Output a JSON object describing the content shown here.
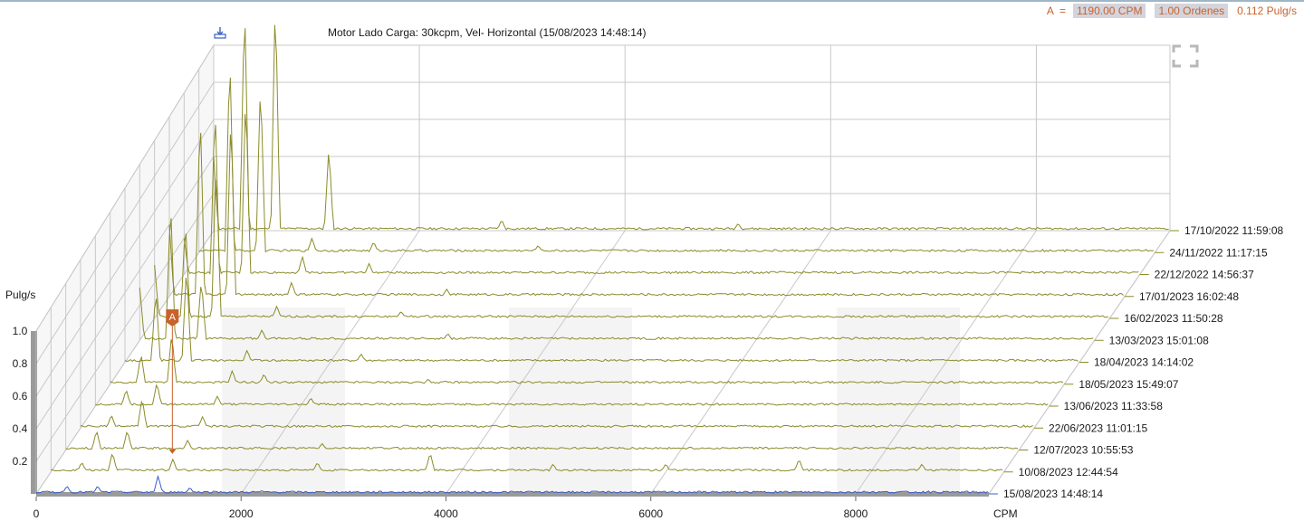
{
  "header": {
    "cursor_label": "A",
    "cursor_equals": "=",
    "cursor_frequency": "1190.00 CPM",
    "cursor_orders": "1.00 Ordenes",
    "cursor_amplitude": "0.112 Pulg/s"
  },
  "icons": {
    "download": "download-icon",
    "expand": "expand-icon"
  },
  "colors": {
    "trace": "#8b8b2a",
    "current_trace": "#3a5fc8",
    "marker": "#c8622a",
    "grid": "#c8c8c8",
    "band": "#ededed"
  },
  "chart_data": {
    "type": "line",
    "title": "Motor Lado Carga: 30kcpm, Vel- Horizontal (15/08/2023 14:48:14)",
    "xlabel": "CPM",
    "ylabel": "Pulg/s",
    "xlim": [
      0,
      9300
    ],
    "ylim": [
      0,
      1.0
    ],
    "x_ticks": [
      0,
      2000,
      4000,
      6000,
      8000
    ],
    "y_ticks": [
      0.2,
      0.4,
      0.6,
      0.8,
      1.0
    ],
    "x_tick_labels": [
      "0",
      "2000",
      "4000",
      "6000",
      "8000"
    ],
    "y_tick_labels": [
      "0.2",
      "0.4",
      "0.6",
      "0.8",
      "1.0"
    ],
    "grid": true,
    "cursor": {
      "label": "A",
      "x": 1190
    },
    "series": [
      {
        "name": "17/10/2022 11:59:08",
        "peaks": [
          [
            0,
            0.4
          ],
          [
            300,
            1.26
          ],
          [
            600,
            1.28
          ],
          [
            1120,
            0.45
          ],
          [
            2800,
            0.06
          ],
          [
            5100,
            0.04
          ]
        ]
      },
      {
        "name": "24/11/2022 11:17:15",
        "peaks": [
          [
            300,
            1.1
          ],
          [
            600,
            0.95
          ],
          [
            1100,
            0.08
          ],
          [
            1700,
            0.06
          ],
          [
            3300,
            0.04
          ]
        ]
      },
      {
        "name": "22/12/2022 14:56:37",
        "peaks": [
          [
            0,
            0.2
          ],
          [
            300,
            0.95
          ],
          [
            600,
            1.02
          ],
          [
            1150,
            0.1
          ],
          [
            1800,
            0.06
          ]
        ]
      },
      {
        "name": "17/01/2023 16:02:48",
        "peaks": [
          [
            0,
            0.4
          ],
          [
            300,
            1.05
          ],
          [
            600,
            1.04
          ],
          [
            1190,
            0.08
          ],
          [
            2700,
            0.04
          ]
        ]
      },
      {
        "name": "16/02/2023 11:50:28",
        "peaks": [
          [
            0,
            0.3
          ],
          [
            300,
            0.55
          ],
          [
            600,
            0.9
          ],
          [
            1190,
            0.07
          ],
          [
            2400,
            0.04
          ]
        ]
      },
      {
        "name": "13/03/2023 15:01:08",
        "peaks": [
          [
            0,
            0.3
          ],
          [
            300,
            0.8
          ],
          [
            600,
            0.35
          ],
          [
            1190,
            0.06
          ],
          [
            3000,
            0.04
          ]
        ]
      },
      {
        "name": "18/04/2023 14:14:02",
        "peaks": [
          [
            300,
            0.42
          ],
          [
            600,
            0.56
          ],
          [
            1190,
            0.07
          ],
          [
            2300,
            0.05
          ]
        ]
      },
      {
        "name": "18/05/2023 15:49:07",
        "peaks": [
          [
            300,
            0.18
          ],
          [
            600,
            0.3
          ],
          [
            1190,
            0.08
          ],
          [
            1500,
            0.06
          ],
          [
            3100,
            0.03
          ]
        ]
      },
      {
        "name": "13/06/2023 11:33:58",
        "peaks": [
          [
            300,
            0.1
          ],
          [
            600,
            0.14
          ],
          [
            1190,
            0.06
          ],
          [
            2100,
            0.05
          ]
        ]
      },
      {
        "name": "22/06/2023 11:01:15",
        "peaks": [
          [
            300,
            0.08
          ],
          [
            600,
            0.18
          ],
          [
            1190,
            0.07
          ],
          [
            7900,
            0.02
          ]
        ]
      },
      {
        "name": "12/07/2023 10:55:53",
        "peaks": [
          [
            300,
            0.12
          ],
          [
            600,
            0.12
          ],
          [
            1190,
            0.06
          ],
          [
            2500,
            0.04
          ]
        ]
      },
      {
        "name": "10/08/2023 12:44:54",
        "peaks": [
          [
            300,
            0.06
          ],
          [
            600,
            0.12
          ],
          [
            1190,
            0.08
          ],
          [
            2600,
            0.06
          ],
          [
            3700,
            0.12
          ],
          [
            4900,
            0.05
          ],
          [
            6000,
            0.05
          ],
          [
            7300,
            0.08
          ],
          [
            8500,
            0.05
          ]
        ]
      },
      {
        "name": "15/08/2023 14:48:14",
        "peaks": [
          [
            300,
            0.05
          ],
          [
            600,
            0.05
          ],
          [
            1190,
            0.112
          ],
          [
            1500,
            0.04
          ],
          [
            2200,
            0.02
          ]
        ]
      }
    ]
  }
}
